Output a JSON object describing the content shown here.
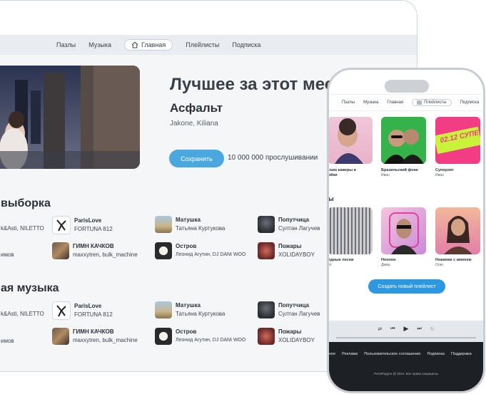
{
  "desktop": {
    "nav": [
      "Пазлы",
      "Музыка",
      "Главная",
      "Плейлисты",
      "Подписка"
    ],
    "hero": {
      "title": "Лучшее за этот мес",
      "song": "Асфальт",
      "artists": "Jakone, Kiliana",
      "save_label": "Сохранить",
      "listens": "10 000 000 прослушивании"
    },
    "section1": {
      "title": "выборка",
      "left_artist_1": "k&Asti, NILETTO",
      "left_artist_2": "имов",
      "tracks": [
        {
          "name": "ParisLove",
          "artist": "FORTUNA 812"
        },
        {
          "name": "Матушка",
          "artist": "Татьяна Куртукова"
        },
        {
          "name": "Попутчица",
          "artist": "Султан Лагучев"
        },
        {
          "name": "ГИМН КАЧКОВ",
          "artist": "maxxytren, bulk_machine"
        },
        {
          "name": "Остров",
          "artist": "Леонид Агутин, DJ DANI WOO"
        },
        {
          "name": "Пожары",
          "artist": "XOLIDAYBOY"
        }
      ]
    },
    "section2": {
      "title": "ая музыка",
      "left_artist_1": "k&Asti, NILETTO",
      "left_artist_2": "имов",
      "tracks": [
        {
          "name": "ParisLove",
          "artist": "FORTUNA 812"
        },
        {
          "name": "Матушка",
          "artist": "Татьяна Куртукова"
        },
        {
          "name": "Попутчица",
          "artist": "Султан Лагучев"
        },
        {
          "name": "ГИМН КАЧКОВ",
          "artist": "maxxytren, bulk_machine"
        },
        {
          "name": "Остров",
          "artist": "Леонид Агутин, DJ DANI WOO"
        },
        {
          "name": "Пожары",
          "artist": "XOLIDAYBOY"
        }
      ]
    }
  },
  "phone": {
    "nav": [
      "Пазлы",
      "Музыка",
      "Главная",
      "Плейлисты",
      "Подписка"
    ],
    "row1": [
      {
        "title": "ские каверы и",
        "title2": "ейки",
        "author": ""
      },
      {
        "title": "Бразильский фонк",
        "author": "Иван"
      },
      {
        "title": "Суперхит",
        "author": "Иван",
        "cover_text": "02.12 СУПЕРХИТ"
      }
    ],
    "section_title": "ы",
    "row2": [
      {
        "title": "одные песни",
        "author": "ет"
      },
      {
        "title": "Нeoнoн",
        "author": "Дима"
      },
      {
        "title": "Новинки с именем",
        "author": "Олег"
      }
    ],
    "create_label": "Создать новый плейлист",
    "footer_links": [
      "ное",
      "Реклама",
      "Пользовательское соглашение",
      "Подписка",
      "Поддержка"
    ],
    "copyright": "РитмРадуги @ 2024. Все права защищены"
  },
  "colors": {
    "accent": "#4aa8de",
    "phone_button": "#2d98df",
    "footer": "#1d2025"
  }
}
